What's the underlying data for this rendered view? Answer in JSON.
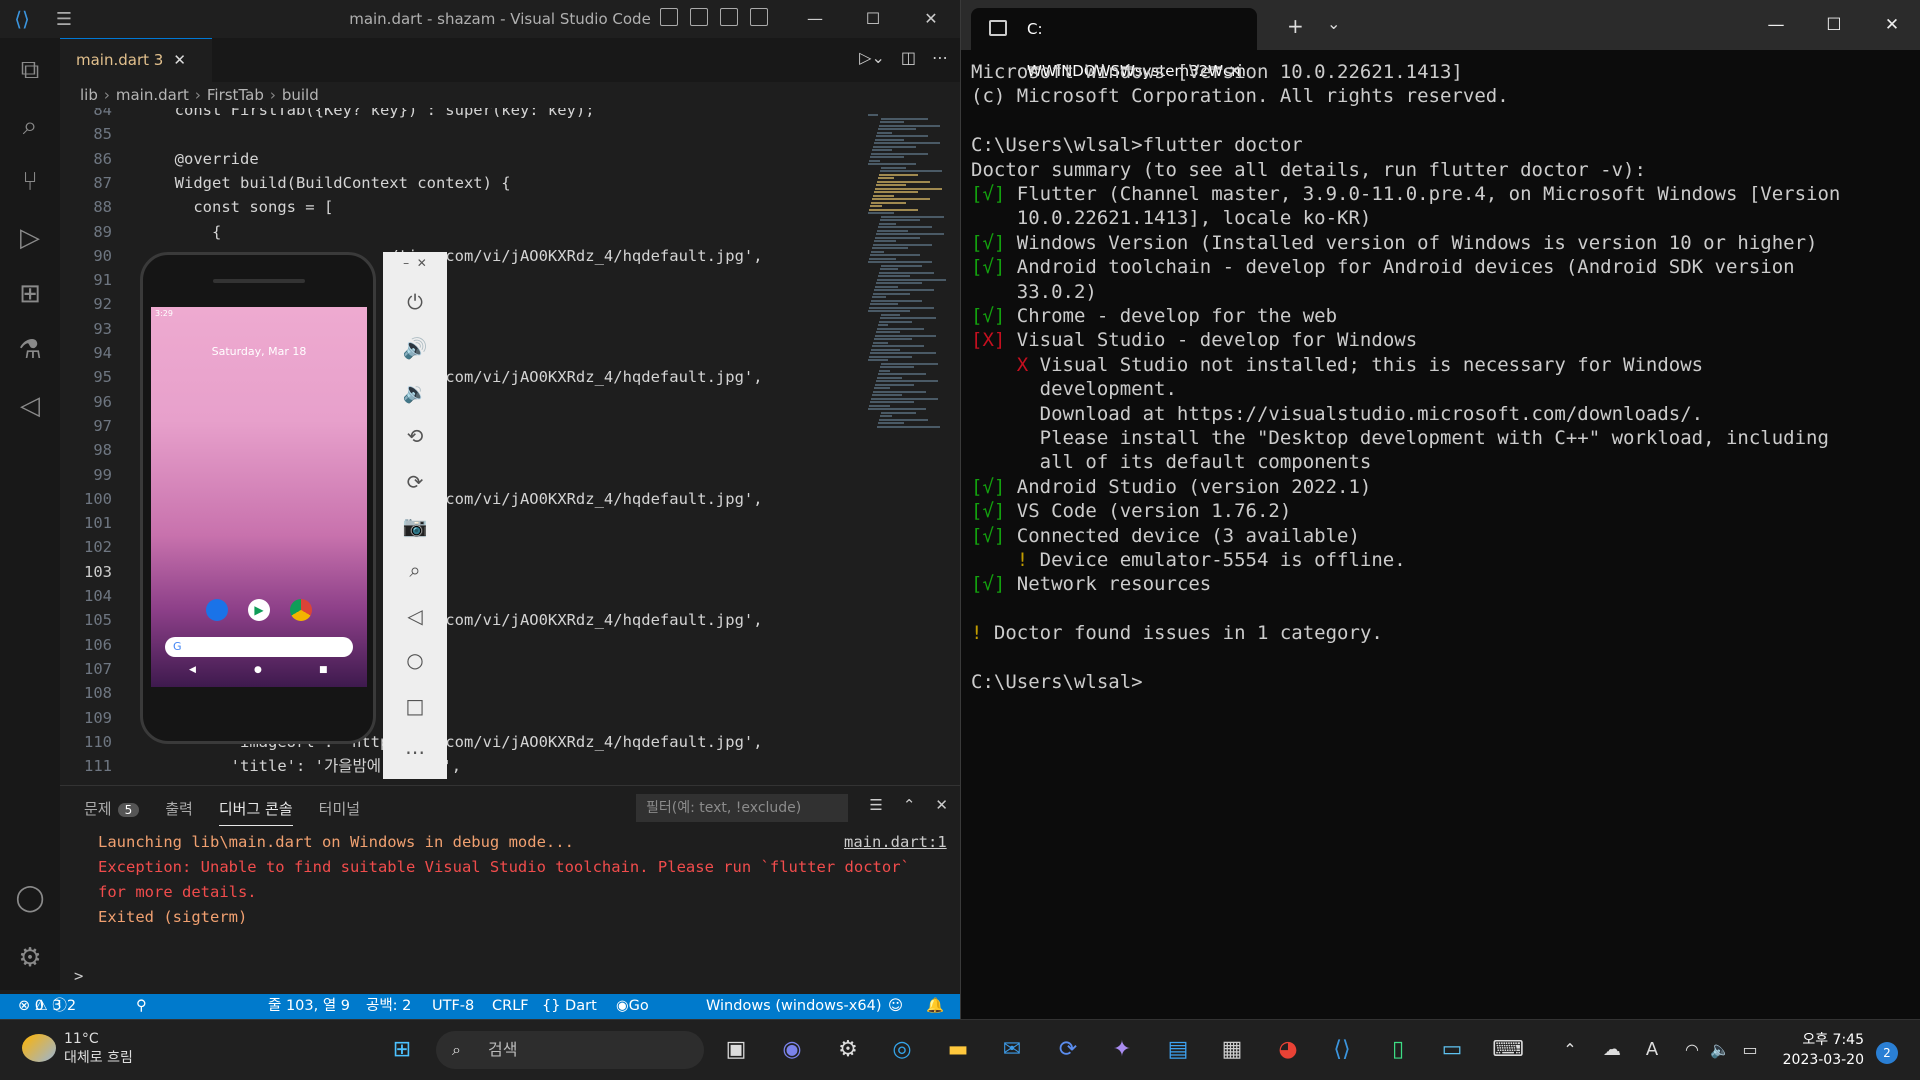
{
  "vscode": {
    "title": "main.dart - shazam - Visual Studio Code",
    "tab": {
      "label": "main.dart 3",
      "close": "✕"
    },
    "breadcrumb": {
      "folder": "lib",
      "file": "main.dart",
      "class": "FirstTab",
      "method": "build"
    },
    "editor": {
      "current_line": 103,
      "lines": [
        {
          "n": "84",
          "t": "  const FirstTab({Key? key}) : super(key: key);"
        },
        {
          "n": "85",
          "t": ""
        },
        {
          "n": "86",
          "t": "  @override"
        },
        {
          "n": "87",
          "t": "  Widget build(BuildContext context) {"
        },
        {
          "n": "88",
          "t": "    const songs = ["
        },
        {
          "n": "89",
          "t": "      {"
        },
        {
          "n": "90",
          "t": "                         /timg.com/vi/jAO0KXRdz_4/hqdefault.jpg',"
        },
        {
          "n": "91",
          "t": "                         각',"
        },
        {
          "n": "92",
          "t": ""
        },
        {
          "n": "93",
          "t": ""
        },
        {
          "n": "94",
          "t": ""
        },
        {
          "n": "95",
          "t": "                         /timg.com/vi/jAO0KXRdz_4/hqdefault.jpg',"
        },
        {
          "n": "96",
          "t": "                         각',"
        },
        {
          "n": "97",
          "t": ""
        },
        {
          "n": "98",
          "t": ""
        },
        {
          "n": "99",
          "t": ""
        },
        {
          "n": "100",
          "t": "                         /timg.com/vi/jAO0KXRdz_4/hqdefault.jpg',"
        },
        {
          "n": "101",
          "t": "                         각',"
        },
        {
          "n": "102",
          "t": ""
        },
        {
          "n": "103",
          "t": ""
        },
        {
          "n": "104",
          "t": ""
        },
        {
          "n": "105",
          "t": "                         /timg.com/vi/jAO0KXRdz_4/hqdefault.jpg',"
        },
        {
          "n": "106",
          "t": "                         각',"
        },
        {
          "n": "107",
          "t": ""
        },
        {
          "n": "108",
          "t": ""
        },
        {
          "n": "109",
          "t": ""
        },
        {
          "n": "110",
          "t": "        'imageUrl': 'http/timg.com/vi/jAO0KXRdz_4/hqdefault.jpg',"
        },
        {
          "n": "111",
          "t": "        'title': '가을밤에 든 생각',"
        }
      ]
    },
    "panel": {
      "tabs": [
        {
          "label": "문제",
          "badge": "5"
        },
        {
          "label": "출력"
        },
        {
          "label": "디버그 콘솔"
        },
        {
          "label": "터미널"
        }
      ],
      "filter_placeholder": "필터(예: text, !exclude)",
      "log": [
        "Launching lib\\main.dart on Windows in debug mode...",
        "Exception: Unable to find suitable Visual Studio toolchain. Please run `flutter doctor`",
        "for more details.",
        "Exited (sigterm)"
      ],
      "log_link": "main.dart:1",
      "prompt": ">"
    },
    "status": {
      "errors": "0",
      "warnings": "3",
      "infos": "2",
      "position": "줄 103, 열 9",
      "spaces": "공백: 2",
      "encoding": "UTF-8",
      "eol": "CRLF",
      "language": "{} Dart",
      "golive": "Go Live",
      "device": "Windows (windows-x64)"
    }
  },
  "emulator": {
    "date": "Saturday, Mar 18",
    "time": "3:29"
  },
  "terminal": {
    "tab_title": "C:₩WINDOWS₩system32₩cm",
    "lines": [
      {
        "t": "Microsoft Windows [Version 10.0.22621.1413]"
      },
      {
        "t": "(c) Microsoft Corporation. All rights reserved."
      },
      {
        "t": ""
      },
      {
        "t": "C:\\Users\\wlsal>flutter doctor"
      },
      {
        "t": "Doctor summary (to see all details, run flutter doctor -v):"
      },
      {
        "m": "[√]",
        "c": "g",
        "t": " Flutter (Channel master, 3.9.0-11.0.pre.4, on Microsoft Windows [Version"
      },
      {
        "t": "    10.0.22621.1413], locale ko-KR)"
      },
      {
        "m": "[√]",
        "c": "g",
        "t": " Windows Version (Installed version of Windows is version 10 or higher)"
      },
      {
        "m": "[√]",
        "c": "g",
        "t": " Android toolchain - develop for Android devices (Android SDK version"
      },
      {
        "t": "    33.0.2)"
      },
      {
        "m": "[√]",
        "c": "g",
        "t": " Chrome - develop for the web"
      },
      {
        "m": "[X]",
        "c": "r",
        "t": " Visual Studio - develop for Windows"
      },
      {
        "m": "    X",
        "c": "r",
        "t": " Visual Studio not installed; this is necessary for Windows"
      },
      {
        "t": "      development."
      },
      {
        "t": "      Download at https://visualstudio.microsoft.com/downloads/."
      },
      {
        "t": "      Please install the \"Desktop development with C++\" workload, including"
      },
      {
        "t": "      all of its default components"
      },
      {
        "m": "[√]",
        "c": "g",
        "t": " Android Studio (version 2022.1)"
      },
      {
        "m": "[√]",
        "c": "g",
        "t": " VS Code (version 1.76.2)"
      },
      {
        "m": "[√]",
        "c": "g",
        "t": " Connected device (3 available)"
      },
      {
        "m": "    !",
        "c": "y",
        "t": " Device emulator-5554 is offline."
      },
      {
        "m": "[√]",
        "c": "g",
        "t": " Network resources"
      },
      {
        "t": ""
      },
      {
        "m": "!",
        "c": "y",
        "t": " Doctor found issues in 1 category."
      },
      {
        "t": ""
      },
      {
        "t": "C:\\Users\\wlsal>"
      }
    ]
  },
  "taskbar": {
    "weather_temp": "11°C",
    "weather_desc": "대체로 흐림",
    "search_label": "검색",
    "time": "오후 7:45",
    "date": "2023-03-20",
    "notifications": "2"
  }
}
